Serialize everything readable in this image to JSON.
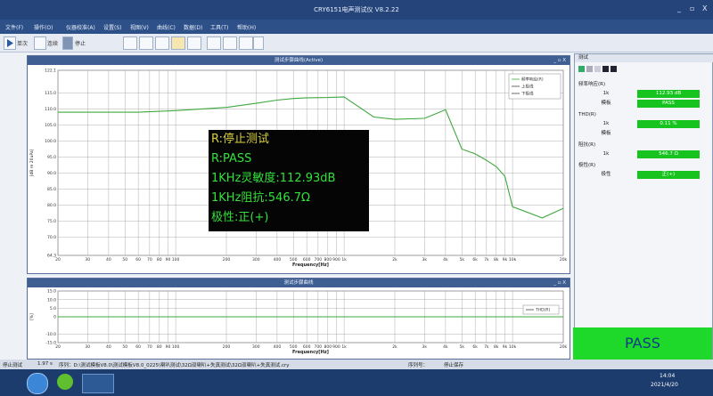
{
  "app": {
    "title": "CRY6151电声测试仪 V8.2.22",
    "min": "_",
    "restore": "▫",
    "close": "X"
  },
  "menu": [
    "文件(F)",
    "操作(O)",
    "仪器校准(A)",
    "设置(S)",
    "视图(V)",
    "曲线(C)",
    "数据(D)",
    "工具(T)",
    "帮助(H)"
  ],
  "toolbar": {
    "single": "单次",
    "loop": "连续",
    "stop": "停止"
  },
  "panel1": {
    "title": "测试步骤曲线(Active)"
  },
  "panel2": {
    "title": "测试步骤曲线"
  },
  "chart_data": [
    {
      "type": "line",
      "x": [
        20,
        30,
        40,
        50,
        60,
        100,
        200,
        300,
        400,
        500,
        600,
        800,
        1000,
        1500,
        2000,
        3000,
        4000,
        5000,
        6000,
        7000,
        8000,
        9000,
        10000,
        15000,
        20000
      ],
      "series": [
        {
          "name": "频率响应(R)",
          "values": [
            109,
            109,
            109,
            109,
            109,
            109.5,
            110.5,
            111.8,
            112.8,
            113.3,
            113.5,
            113.6,
            113.8,
            107.5,
            106.8,
            107.1,
            109.8,
            97.5,
            96,
            94,
            92,
            89,
            79.5,
            76,
            79
          ]
        },
        {
          "name": "上极线",
          "values": []
        },
        {
          "name": "下极线",
          "values": []
        }
      ],
      "yticks": [
        "122.1",
        "115.0",
        "110.0",
        "105.0",
        "100.0",
        "95.0",
        "90.0",
        "85.0",
        "80.0",
        "75.0",
        "70.0",
        "64.3"
      ],
      "xticks": [
        "20",
        "30",
        "40",
        "50",
        "60",
        "70",
        "80",
        "90",
        "100",
        "200",
        "300",
        "400",
        "500",
        "600",
        "700",
        "800",
        "900",
        "1k",
        "2k",
        "3k",
        "4k",
        "5k",
        "6k",
        "7k",
        "8k",
        "9k",
        "10k",
        "20k"
      ],
      "xlabel": "Frequency[Hz]",
      "ylabel": "[dB re 20uPa]",
      "ylim": [
        64.3,
        122.1
      ],
      "xscale": "log",
      "grid": true,
      "legend": "top-right"
    },
    {
      "type": "line",
      "x": [
        20,
        20000
      ],
      "series": [
        {
          "name": "THD(R)",
          "values": [
            0,
            0
          ]
        }
      ],
      "yticks": [
        "15.0",
        "10.0",
        "5.0",
        "0",
        "-10.0",
        "-15.0"
      ],
      "xticks": [
        "20",
        "30",
        "40",
        "50",
        "60",
        "70",
        "80",
        "90",
        "100",
        "200",
        "300",
        "400",
        "500",
        "600",
        "700",
        "800",
        "900",
        "1k",
        "2k",
        "3k",
        "4k",
        "5k",
        "6k",
        "7k",
        "8k",
        "9k",
        "10k",
        "20k"
      ],
      "xlabel": "Frequency[Hz]",
      "ylabel": "[%]",
      "ylim": [
        -15,
        15
      ],
      "xscale": "log",
      "grid": true,
      "legend": "top-right"
    }
  ],
  "overlay": {
    "l1": "R:停止测试",
    "l2": "R:PASS",
    "l3": "1KHz灵敏度:112.93dB",
    "l4": "1KHz阻抗:546.7Ω",
    "l5": "极性:正(+)"
  },
  "right": {
    "title": "测试",
    "g1": "频率响应(R)",
    "r1k": "1k",
    "r1v": "112.93 dB",
    "r2k": "模板",
    "r2v": "PASS",
    "g2": "THD(R)",
    "r3k": "1k",
    "r3v": "0.11 %",
    "r4k": "模板",
    "g3": "阻抗(R)",
    "r5k": "1k",
    "r5v": "546.7 Ω",
    "g4": "极性(R)",
    "r6k": "极性",
    "r6v": "正(+)",
    "pass": "PASS"
  },
  "status": {
    "s1": "停止测试",
    "s2": "1.97 s",
    "s3": "序列：D:\\测试模板V8.0\\测试模板V8.0_0225\\喇叭测试\\32Ω双喇叭+失真测试\\32Ω双喇叭+失真测试.cry",
    "s4": "序列号：",
    "s5": "停止保存"
  },
  "taskbar": {
    "time": "14:04",
    "date": "2021/4/20"
  },
  "colors": {
    "curve": "#3fa83f",
    "pass": "#1ed82a",
    "title": "#25457a"
  }
}
